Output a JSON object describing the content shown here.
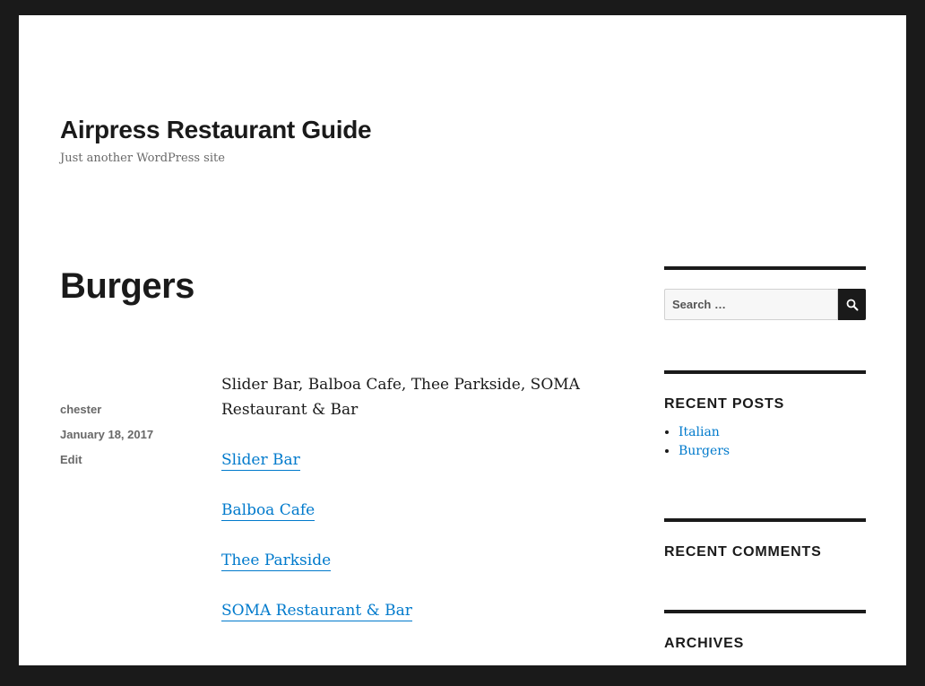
{
  "site": {
    "title": "Airpress Restaurant Guide",
    "description": "Just another WordPress site"
  },
  "post": {
    "title": "Burgers",
    "author": "chester",
    "date": "January 18, 2017",
    "edit_label": "Edit",
    "intro": "Slider Bar, Balboa Cafe, Thee Parkside, SOMA Restaurant & Bar",
    "links": [
      "Slider Bar",
      "Balboa Cafe",
      "Thee Parkside",
      "SOMA Restaurant & Bar"
    ]
  },
  "sidebar": {
    "search": {
      "placeholder": "Search …"
    },
    "recent_posts": {
      "title": "RECENT POSTS",
      "items": [
        "Italian",
        "Burgers"
      ]
    },
    "recent_comments": {
      "title": "RECENT COMMENTS"
    },
    "archives": {
      "title": "ARCHIVES"
    }
  },
  "colors": {
    "frame": "#1a1a1a",
    "link": "#007acc",
    "text": "#1a1a1a",
    "muted": "#686868"
  },
  "icons": {
    "search_button": "search-icon"
  }
}
